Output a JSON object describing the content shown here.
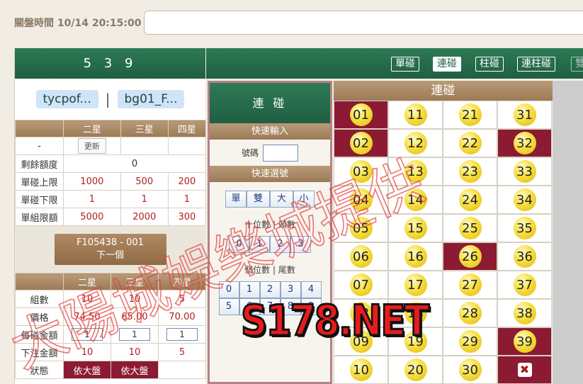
{
  "topbar": {
    "close_label": "關盤時間 10/14 20:15:00",
    "close_value": ""
  },
  "left": {
    "title": "5 3 9",
    "accounts": [
      "tycpof...",
      "bg01_F..."
    ],
    "separator": "|",
    "limit_table": {
      "headers": [
        "",
        "二星",
        "三星",
        "四星"
      ],
      "refresh_label": "更新",
      "refresh_row_label": "-",
      "rows": [
        {
          "label": "剩餘額度",
          "values": [
            "0"
          ]
        },
        {
          "label": "單碰上限",
          "values": [
            "1000",
            "500",
            "200"
          ]
        },
        {
          "label": "單碰下限",
          "values": [
            "1",
            "1",
            "1"
          ]
        },
        {
          "label": "單組限額",
          "values": [
            "5000",
            "2000",
            "300"
          ]
        }
      ]
    },
    "next_button": {
      "line1": "F105438 - 001",
      "line2": "下一個"
    },
    "bet_table": {
      "headers": [
        "",
        "二星",
        "三星",
        "四星"
      ],
      "rows": [
        {
          "label": "組數",
          "values": [
            "10",
            "10",
            "5"
          ]
        },
        {
          "label": "價格",
          "values": [
            "74.50",
            "65.00",
            "70.00"
          ]
        },
        {
          "label": "每碰金額",
          "inputs": [
            "1",
            "1",
            "1"
          ]
        },
        {
          "label": "下注金額",
          "values": [
            "10",
            "10",
            "5"
          ]
        },
        {
          "label": "狀態",
          "status": [
            "依大盤",
            "依大盤",
            ""
          ]
        }
      ]
    }
  },
  "game_tabs": [
    {
      "label": "單碰",
      "active": false
    },
    {
      "label": "連碰",
      "active": true
    },
    {
      "label": "柱碰",
      "active": false
    },
    {
      "label": "連柱碰",
      "active": false
    },
    {
      "label": "雙",
      "active": false
    }
  ],
  "mid": {
    "title": "連 碰",
    "quick_input_header": "快速輸入",
    "code_label": "號碼",
    "code_value": "",
    "quick_select_header": "快速選號",
    "parity_size_buttons": [
      "單",
      "雙",
      "大",
      "小"
    ],
    "tens_label": "十位數 | 頭數",
    "tens_buttons": [
      "0",
      "1",
      "2",
      "3"
    ],
    "units_label": "個位數 | 尾數",
    "units_buttons_row1": [
      "0",
      "1",
      "2",
      "3",
      "4"
    ],
    "units_buttons_row2": [
      "5",
      "6",
      "7",
      "8",
      "9"
    ]
  },
  "number_grid": {
    "header": "連碰",
    "columns": [
      [
        "01",
        "02",
        "03",
        "04",
        "05",
        "06",
        "07",
        "08",
        "09",
        "10"
      ],
      [
        "11",
        "12",
        "13",
        "14",
        "15",
        "16",
        "17",
        "18",
        "19",
        "20"
      ],
      [
        "21",
        "22",
        "23",
        "24",
        "25",
        "26",
        "27",
        "28",
        "29",
        "30"
      ],
      [
        "31",
        "32",
        "33",
        "34",
        "35",
        "36",
        "37",
        "38",
        "39",
        ""
      ]
    ],
    "selected": [
      "01",
      "02",
      "26",
      "32",
      "39"
    ],
    "clear_icon": "close-icon"
  },
  "overlay": {
    "brand_text": "S178.NET",
    "watermark_text": "大陽城娛樂城提供"
  }
}
